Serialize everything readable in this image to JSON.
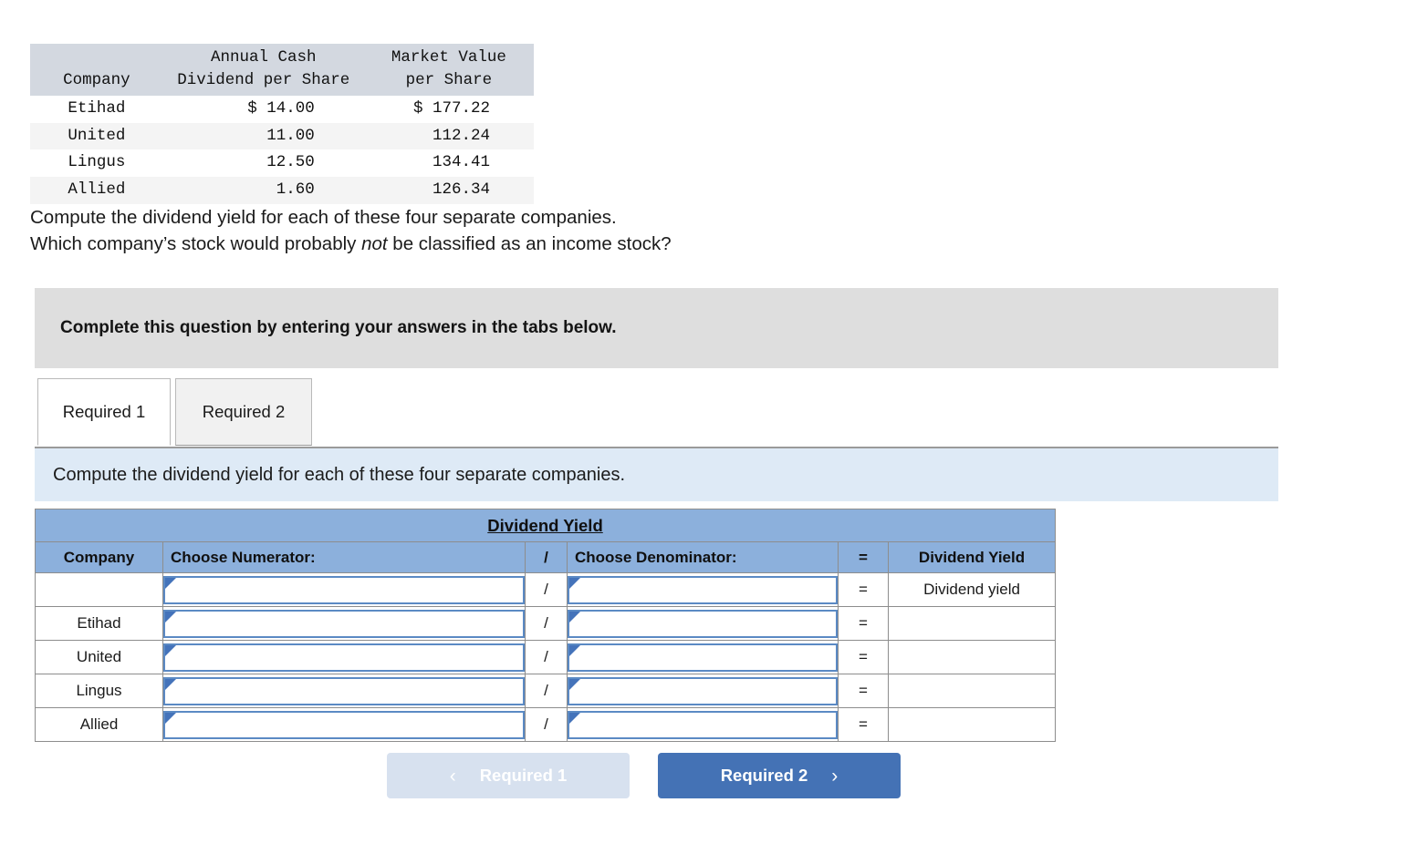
{
  "source_table": {
    "headers": {
      "company": "Company",
      "dividend": "Annual Cash\nDividend per Share",
      "market_value": "Market Value\nper Share"
    },
    "rows": [
      {
        "company": "Etihad",
        "dividend": "$ 14.00",
        "market_value": "$ 177.22"
      },
      {
        "company": "United",
        "dividend": "11.00",
        "market_value": "112.24"
      },
      {
        "company": "Lingus",
        "dividend": "12.50",
        "market_value": "134.41"
      },
      {
        "company": "Allied",
        "dividend": "1.60",
        "market_value": "126.34"
      }
    ]
  },
  "prompt": {
    "line1": "Compute the dividend yield for each of these four separate companies.",
    "line2_pre": "Which company’s stock would probably ",
    "line2_em": "not",
    "line2_post": " be classified as an income stock?"
  },
  "banner": {
    "text": "Complete this question by entering your answers in the tabs below."
  },
  "tabs": [
    {
      "label": "Required 1",
      "active": true
    },
    {
      "label": "Required 2",
      "active": false
    }
  ],
  "subbar": {
    "text": "Compute the dividend yield for each of these four separate companies."
  },
  "grid": {
    "title": "Dividend Yield",
    "headers": {
      "company": "Company",
      "numerator": "Choose Numerator:",
      "slash": "/",
      "denominator": "Choose Denominator:",
      "equals": "=",
      "result": "Dividend Yield"
    },
    "rows": [
      {
        "company": "",
        "numerator": "",
        "slash": "/",
        "denominator": "",
        "equals": "=",
        "result": "Dividend yield"
      },
      {
        "company": "Etihad",
        "numerator": "",
        "slash": "/",
        "denominator": "",
        "equals": "=",
        "result": ""
      },
      {
        "company": "United",
        "numerator": "",
        "slash": "/",
        "denominator": "",
        "equals": "=",
        "result": ""
      },
      {
        "company": "Lingus",
        "numerator": "",
        "slash": "/",
        "denominator": "",
        "equals": "=",
        "result": ""
      },
      {
        "company": "Allied",
        "numerator": "",
        "slash": "/",
        "denominator": "",
        "equals": "=",
        "result": ""
      }
    ]
  },
  "nav": {
    "prev_label": "Required 1",
    "prev_icon": "chevron-left-icon",
    "prev_chevron": "‹",
    "next_label": "Required 2",
    "next_icon": "chevron-right-icon",
    "next_chevron": "›"
  },
  "colors": {
    "grid_header_blue": "#8cb0dc",
    "subbar_blue": "#deeaf6",
    "banner_gray": "#dedede",
    "source_header": "#d3d8e0",
    "next_button": "#4472b5",
    "prev_button_disabled": "#d7e1ef",
    "input_border": "#5b8ac4",
    "marker_blue": "#4473ba"
  }
}
